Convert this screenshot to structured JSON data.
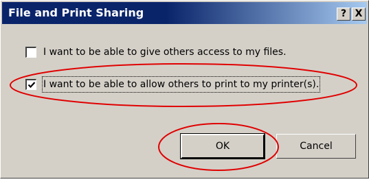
{
  "dialog": {
    "title": "File and Print Sharing",
    "help_button": "?",
    "close_button": "X"
  },
  "options": [
    {
      "label": "I want to be able to give others access to my files.",
      "checked": false
    },
    {
      "label": "I want to be able to allow others to print to my printer(s).",
      "checked": true
    }
  ],
  "buttons": {
    "ok": "OK",
    "cancel": "Cancel"
  },
  "colors": {
    "title_bar_start": "#0a246a",
    "title_bar_end": "#a6caf0",
    "dialog_face": "#d4d0c8",
    "annotation_ring": "#e00000"
  }
}
